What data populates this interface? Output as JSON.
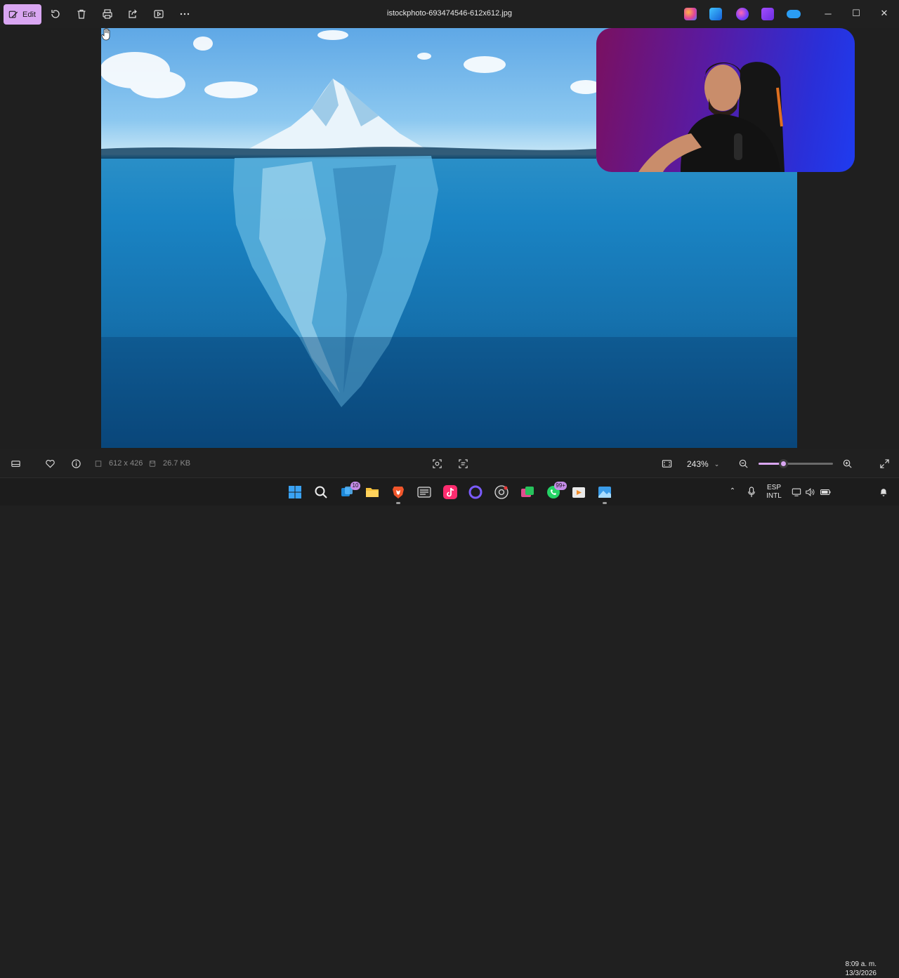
{
  "window": {
    "file_title": "istockphoto-693474546-612x612.jpg"
  },
  "toolbar": {
    "edit_label": "Edit",
    "icons": [
      "rotate-icon",
      "delete-icon",
      "print-icon",
      "share-icon",
      "slideshow-icon",
      "more-icon"
    ]
  },
  "title_tray_apps": [
    "copilot-icon",
    "designer-icon",
    "copilot-color-icon",
    "clipchamp-icon",
    "onedrive-icon"
  ],
  "window_controls": {
    "minimize": "─",
    "maximize": "☐",
    "close": "✕"
  },
  "status": {
    "dimensions": "612 x 426",
    "file_size": "26.7 KB",
    "zoom": "243%",
    "zoom_level_fraction": 0.33
  },
  "taskbar": {
    "apps": [
      {
        "name": "start-icon"
      },
      {
        "name": "search-icon"
      },
      {
        "name": "task-view-icon",
        "badge": "10"
      },
      {
        "name": "file-explorer-icon"
      },
      {
        "name": "brave-browser-icon"
      },
      {
        "name": "media-app-icon"
      },
      {
        "name": "tiktok-icon"
      },
      {
        "name": "cortana-circle-icon"
      },
      {
        "name": "chrome-icon"
      },
      {
        "name": "store-app-icon"
      },
      {
        "name": "whatsapp-icon",
        "badge": "99+"
      },
      {
        "name": "player-app-icon"
      },
      {
        "name": "photos-app-icon"
      }
    ],
    "language_top": "ESP",
    "language_bottom": "INTL",
    "time": "8:09 a. m.",
    "date": "13/3/2026"
  },
  "colors": {
    "accent": "#d9a6f2",
    "background": "#202020"
  }
}
